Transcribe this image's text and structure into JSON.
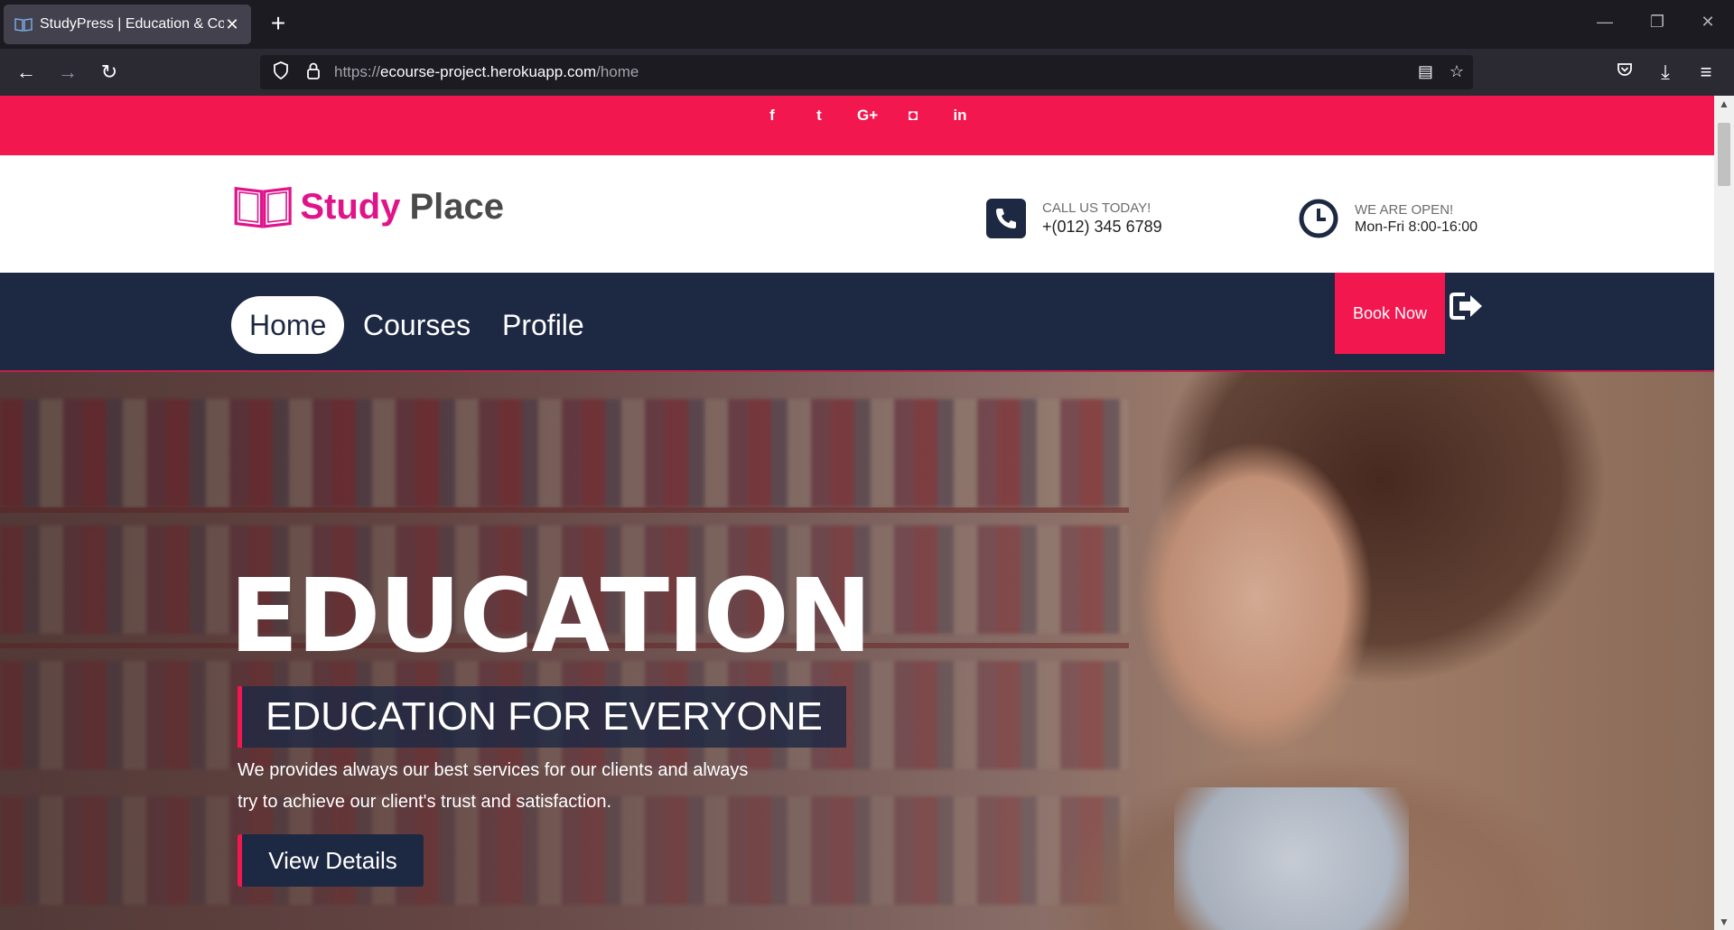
{
  "browser": {
    "tab_title": "StudyPress | Education & Course",
    "url_prefix": "https://",
    "url_host": "ecourse-project.herokuapp.com",
    "url_path": "/home"
  },
  "topbar": {
    "social": [
      "f",
      "t",
      "G+",
      "◘",
      "in"
    ]
  },
  "logo": {
    "study": "Study",
    "place": "Place",
    "colors": {
      "study": "#e0148a",
      "place": "#4a4a4a"
    }
  },
  "contact": {
    "call_label": "CALL US TODAY!",
    "phone": "+(012) 345 6789",
    "open_label": "WE ARE OPEN!",
    "hours": "Mon-Fri 8:00-16:00"
  },
  "menu": {
    "items": [
      "Home",
      "Courses",
      "Profile"
    ],
    "book_now": "Book Now"
  },
  "hero": {
    "title": "EDUCATION",
    "subtitle": "EDUCATION FOR EVERYONE",
    "description_1": "We provides always our best services for our clients and always",
    "description_2": "try to achieve our client's trust and satisfaction.",
    "button": "View Details"
  },
  "colors": {
    "accent": "#f3174f",
    "navy": "#1d2843"
  }
}
